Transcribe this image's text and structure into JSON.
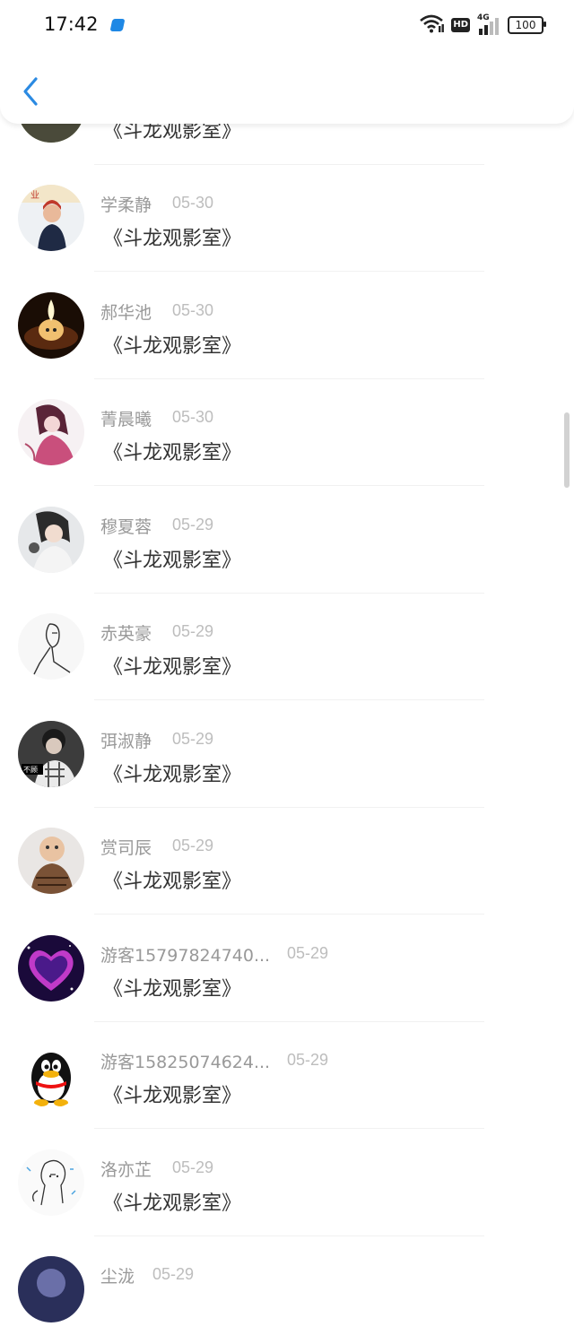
{
  "status": {
    "time": "17:42",
    "hd": "HD",
    "net": "4G",
    "battery": "100"
  },
  "header": {
    "back_icon": "chevron-left-icon"
  },
  "accent": "#2b8ae2",
  "items": [
    {
      "name": "",
      "date": "",
      "title": "《斗龙观影室》"
    },
    {
      "name": "学柔静",
      "date": "05-30",
      "title": "《斗龙观影室》"
    },
    {
      "name": "郝华池",
      "date": "05-30",
      "title": "《斗龙观影室》"
    },
    {
      "name": "菁晨曦",
      "date": "05-30",
      "title": "《斗龙观影室》"
    },
    {
      "name": "穆夏蓉",
      "date": "05-29",
      "title": "《斗龙观影室》"
    },
    {
      "name": "赤英豪",
      "date": "05-29",
      "title": "《斗龙观影室》"
    },
    {
      "name": "弭淑静",
      "date": "05-29",
      "title": "《斗龙观影室》"
    },
    {
      "name": "赏司辰",
      "date": "05-29",
      "title": "《斗龙观影室》"
    },
    {
      "name": "游客15797824740...",
      "date": "05-29",
      "title": "《斗龙观影室》"
    },
    {
      "name": "游客15825074624...",
      "date": "05-29",
      "title": "《斗龙观影室》"
    },
    {
      "name": "洛亦芷",
      "date": "05-29",
      "title": "《斗龙观影室》"
    },
    {
      "name": "尘泷",
      "date": "05-29",
      "title": ""
    }
  ]
}
